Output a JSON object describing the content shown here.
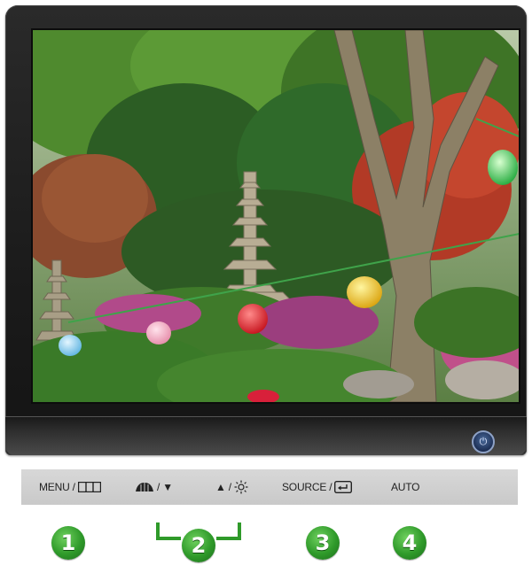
{
  "controls": {
    "menu_label": "MENU /",
    "arrow_down_label": "/ ▼",
    "arrow_up_label": "▲ /",
    "source_label": "SOURCE /",
    "auto_label": "AUTO"
  },
  "badges": [
    "1",
    "2",
    "3",
    "4"
  ],
  "icons": {
    "menu": "menu-grid-icon",
    "magic_bright": "magic-bright-icon",
    "brightness": "brightness-sun-icon",
    "enter": "enter-arrow-icon",
    "power": "power-icon"
  },
  "colors": {
    "badge_green": "#2f9a2a",
    "bezel": "#1e1e1e",
    "control_bar": "#cfcfcf",
    "power_button_ring": "#8ea2c6"
  }
}
